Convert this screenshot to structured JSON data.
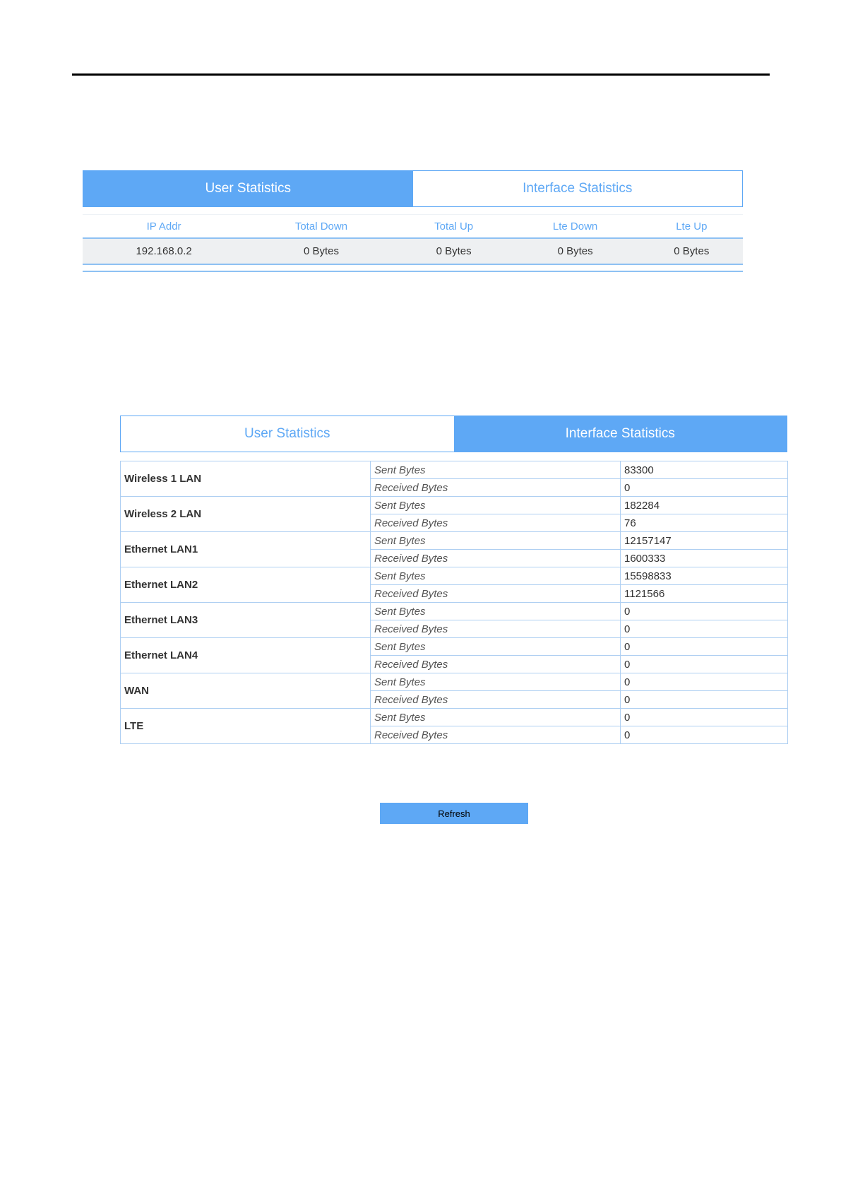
{
  "user_panel": {
    "tabs": [
      {
        "label": "User Statistics",
        "active": true
      },
      {
        "label": "Interface Statistics",
        "active": false
      }
    ],
    "columns": [
      "IP Addr",
      "Total Down",
      "Total Up",
      "Lte Down",
      "Lte Up"
    ],
    "rows": [
      [
        "192.168.0.2",
        "0 Bytes",
        "0 Bytes",
        "0 Bytes",
        "0 Bytes"
      ]
    ]
  },
  "interface_panel": {
    "tabs": [
      {
        "label": "User Statistics",
        "active": false
      },
      {
        "label": "Interface Statistics",
        "active": true
      }
    ],
    "interfaces": [
      {
        "name": "Wireless 1 LAN",
        "sent_label": "Sent Bytes",
        "sent": "83300",
        "received_label": "Received Bytes",
        "received": "0"
      },
      {
        "name": "Wireless 2 LAN",
        "sent_label": "Sent Bytes",
        "sent": "182284",
        "received_label": "Received Bytes",
        "received": "76"
      },
      {
        "name": "Ethernet LAN1",
        "sent_label": "Sent Bytes",
        "sent": "12157147",
        "received_label": "Received Bytes",
        "received": "1600333"
      },
      {
        "name": "Ethernet LAN2",
        "sent_label": "Sent Bytes",
        "sent": "15598833",
        "received_label": "Received Bytes",
        "received": "1121566"
      },
      {
        "name": "Ethernet LAN3",
        "sent_label": "Sent Bytes",
        "sent": "0",
        "received_label": "Received Bytes",
        "received": "0"
      },
      {
        "name": "Ethernet LAN4",
        "sent_label": "Sent Bytes",
        "sent": "0",
        "received_label": "Received Bytes",
        "received": "0"
      },
      {
        "name": "WAN",
        "sent_label": "Sent Bytes",
        "sent": "0",
        "received_label": "Received Bytes",
        "received": "0"
      },
      {
        "name": "LTE",
        "sent_label": "Sent Bytes",
        "sent": "0",
        "received_label": "Received Bytes",
        "received": "0"
      }
    ]
  },
  "refresh_button": {
    "label": "Refresh"
  },
  "colors": {
    "accent": "#5ea8f5",
    "table_border": "#aecff2",
    "row_background": "#eef0f2"
  }
}
